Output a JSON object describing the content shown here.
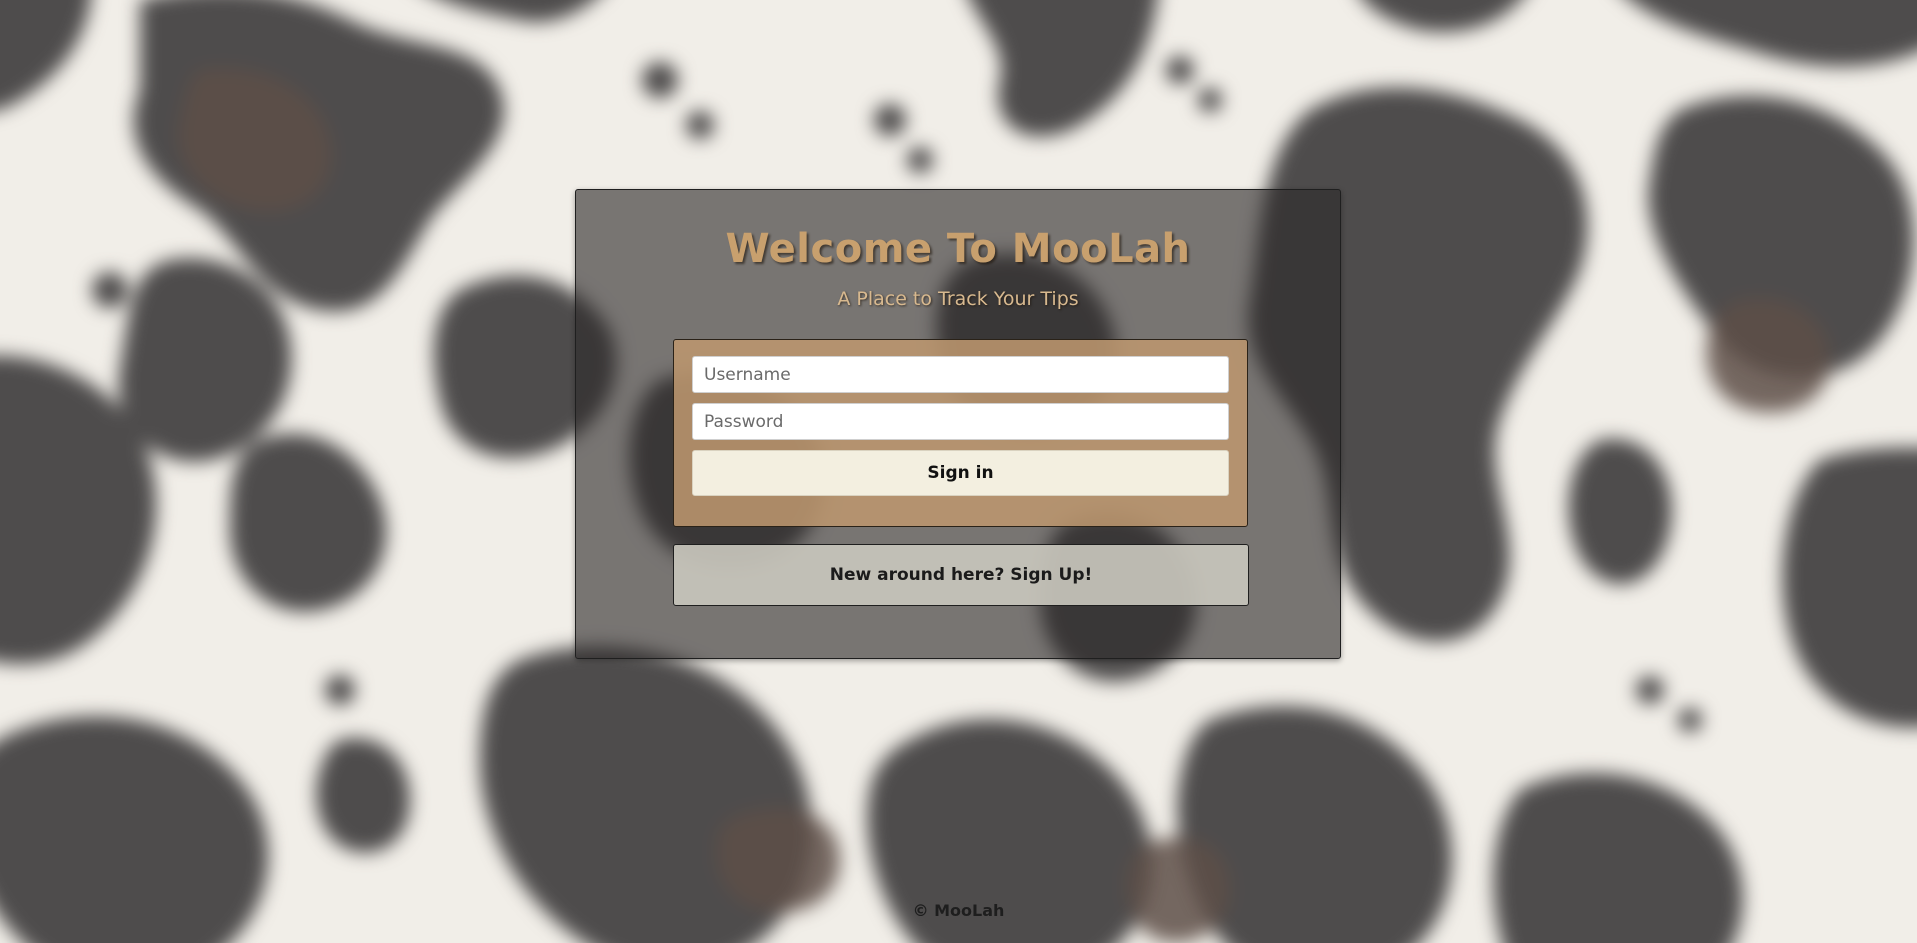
{
  "login_panel": {
    "title": "Welcome To MooLah",
    "subtitle": "A Place to Track Your Tips",
    "username_placeholder": "Username",
    "password_placeholder": "Password",
    "signin_label": "Sign in",
    "signup_label": "New around here? Sign Up!"
  },
  "footer": {
    "copyright": "© MooLah"
  },
  "colors": {
    "title": "#c8a06e",
    "signin_card": "#bc966e",
    "signin_button": "#f3efe0",
    "signup_card": "#c8c6bc",
    "cow_spot_dark": "#4a4848",
    "cow_spot_brown": "#5e4f48"
  }
}
